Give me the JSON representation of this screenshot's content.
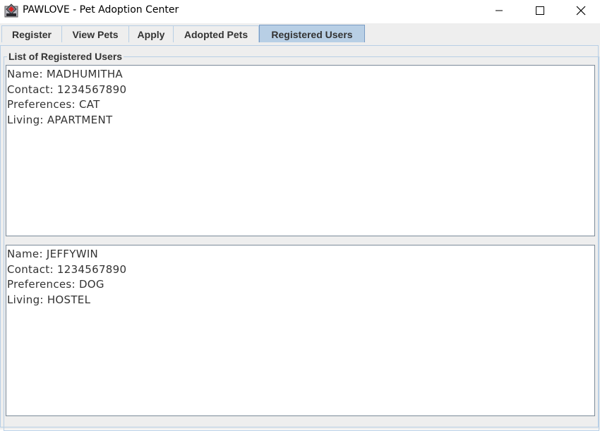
{
  "window": {
    "title": "PAWLOVE - Pet Adoption Center",
    "icon": "app-logo-icon",
    "controls": [
      "minimize-icon",
      "maximize-icon",
      "close-icon"
    ]
  },
  "tabs": [
    {
      "label": "Register",
      "active": false
    },
    {
      "label": "View Pets",
      "active": false
    },
    {
      "label": "Apply",
      "active": false
    },
    {
      "label": "Adopted Pets",
      "active": false
    },
    {
      "label": "Registered Users",
      "active": true
    }
  ],
  "panel": {
    "title": "List of Registered Users",
    "users": [
      {
        "name": "Name: MADHUMITHA",
        "contact": "Contact: 1234567890",
        "preferences": "Preferences: CAT",
        "living": "Living: APARTMENT"
      },
      {
        "name": "Name: JEFFYWIN",
        "contact": "Contact: 1234567890",
        "preferences": "Preferences: DOG",
        "living": "Living: HOSTEL"
      }
    ]
  },
  "colors": {
    "tab_active": "#b8cfe5",
    "tab_border": "#b8cfe5",
    "panel_bg": "#eeeeee",
    "text": "#333333"
  }
}
